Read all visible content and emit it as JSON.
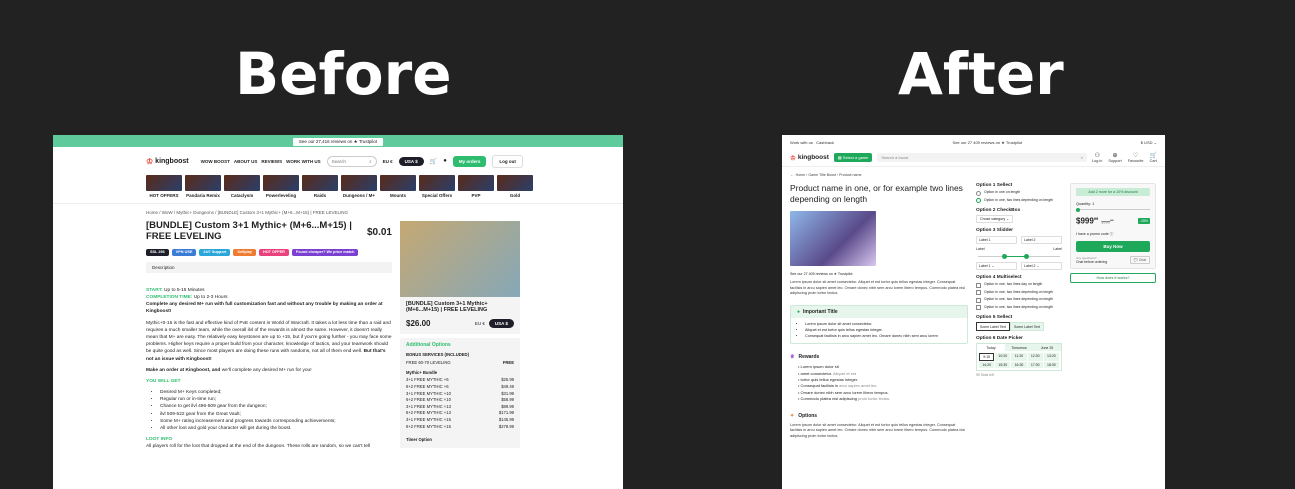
{
  "headings": {
    "before": "Before",
    "after": "After"
  },
  "before": {
    "trust_bar": "See our 27,416 reviews on ★ Trustpilot",
    "logo": "kingboost",
    "menu": [
      "WOW BOOST",
      "ABOUT US",
      "REVIEWS",
      "WORK WITH US"
    ],
    "search_placeholder": "Search",
    "currency": "EU €",
    "currency_btn": "USA $",
    "my_orders": "My orders",
    "logout": "Log out",
    "categories": [
      "HOT OFFERS",
      "Pandaria Remix",
      "Cataclysm",
      "Powerleveling",
      "Raids",
      "Dungeons / M+",
      "Mounts",
      "Special Offers",
      "PVP",
      "Gold"
    ],
    "breadcrumb": "Home  /  WoW  /  Mythic+ Dungeons  /  [BUNDLE] Custom 3+1 Mythic+ (M+6...M+15) | FREE LEVELING",
    "title": "[BUNDLE] Custom 3+1 Mythic+ (M+6...M+15) | FREE LEVELING",
    "price": "$0.01",
    "badges": [
      {
        "label": "SSL 256",
        "color": "#1e1e2a"
      },
      {
        "label": "VPN USE",
        "color": "#3a7bd5"
      },
      {
        "label": "24/7 Support",
        "color": "#2aa7d8"
      },
      {
        "label": "Selfplay",
        "color": "#f07a2f"
      },
      {
        "label": "HOT OFFER",
        "color": "#e8417b"
      },
      {
        "label": "Found cheaper? We price match",
        "color": "#7b3fd1"
      }
    ],
    "description_tab": "Description",
    "start_label": "START:",
    "start_value": "Up to 5-15 Minutes",
    "completion_label": "COMPLETION TIME:",
    "completion_value": "Up to 2-3 Hours",
    "intro_bold": "Complete any desired M+ run with full customization fast and without any trouble by making an order at Kingboost!",
    "intro_text": "Mythic+0-15 is the fast and effective kind of PvE content in World of Warcraft. It takes a lot less time than a raid and requires a much smaller team, while the overall ilvl of the rewards is almost the same. However, it doesn't really mean that M+ are easy. The relatively easy keystones are up to +15, but if you're going further - you may face some problems. Higher keys require a proper build from your character, knowledge of tactics, and your teamwork should be quite good as well. Since most players are doing these runs with randoms, not all of them end well.",
    "intro_end": "But that's not an issue with Kingboost!",
    "order_bold": "Make an order at Kingboost, and",
    "order_text": "we'll complete any desired M+ run for you!",
    "you_will_get": "YOU WILL GET",
    "get_items": [
      "Desired M+ Keys completed;",
      "Regular run or in-time run;",
      "Chance to get ilvl 496-509 gear from the dungeon;",
      "ilvl 509-522 gear from the Great Vault;",
      "Some M+ rating increasement and progress towards corresponding achievements;",
      "All other loot and gold your character will get during the boost."
    ],
    "loot_info": "LOOT INFO",
    "loot_text": "All players roll for the loot that dropped at the end of the dungeon. These rolls are random, so we can't tell",
    "card": {
      "title": "[BUNDLE] Custom 3+1 Mythic+ (M+6...M+15) | FREE LEVELING",
      "price": "$26.00",
      "currency": "EU €",
      "currency_btn": "USA $"
    },
    "options": {
      "header": "Additional Options",
      "bonus_label": "BONUS SERVICES (INCLUDED)",
      "bonus_item": "FREE 60-70 LEVELING",
      "bonus_value": "FREE",
      "bundle_label": "Mythic+ Bundle",
      "bundle_items": [
        {
          "label": "3+1 FREE MYTHIC +6",
          "price": "$25.99"
        },
        {
          "label": "6+2 FREE MYTHIC +6",
          "price": "$49.49"
        },
        {
          "label": "3+1 FREE MYTHIC +10",
          "price": "$31.99"
        },
        {
          "label": "6+2 FREE MYTHIC +10",
          "price": "$58.99"
        },
        {
          "label": "3+1 FREE MYTHIC +13",
          "price": "$89.99"
        },
        {
          "label": "6+2 FREE MYTHIC +13",
          "price": "$171.99"
        },
        {
          "label": "3+1 FREE MYTHIC +15",
          "price": "$145.99"
        },
        {
          "label": "6+2 FREE MYTHIC +15",
          "price": "$278.99"
        }
      ],
      "timer_label": "Timer Option"
    }
  },
  "after": {
    "top_links": [
      "Work with us",
      "Cashback"
    ],
    "trust_bar": "See our 27 409 reviews on ★ Trustpilot",
    "currency": "$ USD",
    "logo": "kingboost",
    "select_game": "Select a game",
    "search_placeholder": "Search a boost",
    "icons": [
      {
        "name": "user",
        "label": "Log in"
      },
      {
        "name": "support",
        "label": "Support"
      },
      {
        "name": "heart",
        "label": "Favourite"
      },
      {
        "name": "cart",
        "label": "Cart"
      }
    ],
    "breadcrumb": "Home  ›  Game Title Boost  ›  Product name",
    "title": "Product name in one, or for example two lines depending on length",
    "reviews": "See our 27 409 reviews on ★ Trustpilot",
    "lorem1": "Lorem ipsum dolor sit amet consectetur. Aliquet et est tortor quis tellus egestas integer. Consequat facilisis in arcu sapien amet leo. Ornare donec nibh sem arcu lorem libero tempus. Commodo platea nisl adipiscing proin tortor lectus.",
    "important_title": "Important Title",
    "important_items": [
      "Lorem ipsum dolor sit amet consectetur.",
      "Aliquet et est tortor quis tellus egestas integer.",
      "Consequat facilisis in arcu sapien amet leo. Ornare donec nibh sem arcu lorem"
    ],
    "rewards_title": "Rewards",
    "rewards_items": [
      {
        "text": "Lorem ipsum dolor sit",
        "muted": ""
      },
      {
        "text": "amet consectetur.",
        "muted": "Aliquet et est"
      },
      {
        "text": "tortor quis tellus egestas integer.",
        "muted": ""
      },
      {
        "text": "Consequat facilisis in",
        "muted": "arcu sapien amet leo."
      },
      {
        "text": "Ornare donec nibh sem arcu lorem libero tempus.",
        "muted": ""
      },
      {
        "text": "Commodo platea nisl adipiscing",
        "muted": "proin tortor lectus."
      }
    ],
    "options_title": "Options",
    "lorem2": "Lorem ipsum dolor sit amet consectetur. Aliquet et est tortor quis tellus egestas integer. Consequat facilisis in arcu sapien amet leo. Ornare donec nibh sem arcu lorem libero tempus. Commodo platea nisl adipiscing proin tortor lectus.",
    "opt1": {
      "title": "Option 1 Sellect",
      "items": [
        "Option in one on length",
        "Option in one, two lines depending on length"
      ]
    },
    "opt2": {
      "title": "Option 2 CheckBox",
      "select": "Chose category"
    },
    "opt3": {
      "title": "Option 3 Slidder",
      "in1": "Label 1",
      "in2": "Label 2",
      "lab_l": "Label",
      "lab_r": "Label",
      "sel1": "Label 1",
      "sel2": "Label 2",
      "value": 0.45
    },
    "opt4": {
      "title": "Option 4 Multiselect",
      "items": [
        "Option in one, two lines day  on length",
        "Option in one, two lines depending on length",
        "Option in one, two lines depending on length",
        "Option in one, two lines depending on length"
      ]
    },
    "opt5": {
      "title": "Option 5 Sellect",
      "on": "Some Label Text",
      "off": "Some Label Text"
    },
    "opt6": {
      "title": "Option 6 Date Picker",
      "days": [
        "Today",
        "Tomorrow",
        "June 25"
      ],
      "times": [
        "9:15",
        "10:20",
        "11:20",
        "12:30",
        "13:20",
        "14:20",
        "15:30",
        "16:30",
        "17:30",
        "18:30"
      ],
      "note": "99 Slots left"
    },
    "card": {
      "promo": "Add 2 more for a 10% discount",
      "quantity": "Quantity: 1",
      "price": "$999",
      "price_sup": "99",
      "old_price": "$999",
      "old_sup": "99",
      "discount": "-15%",
      "promo_code": "I have a promo code ⓘ",
      "buy": "Buy Now",
      "chat_q": "Any questions?",
      "chat_a": "Chat before ordering",
      "chat_btn": "💬 Chat",
      "how": "How does it works?"
    }
  }
}
